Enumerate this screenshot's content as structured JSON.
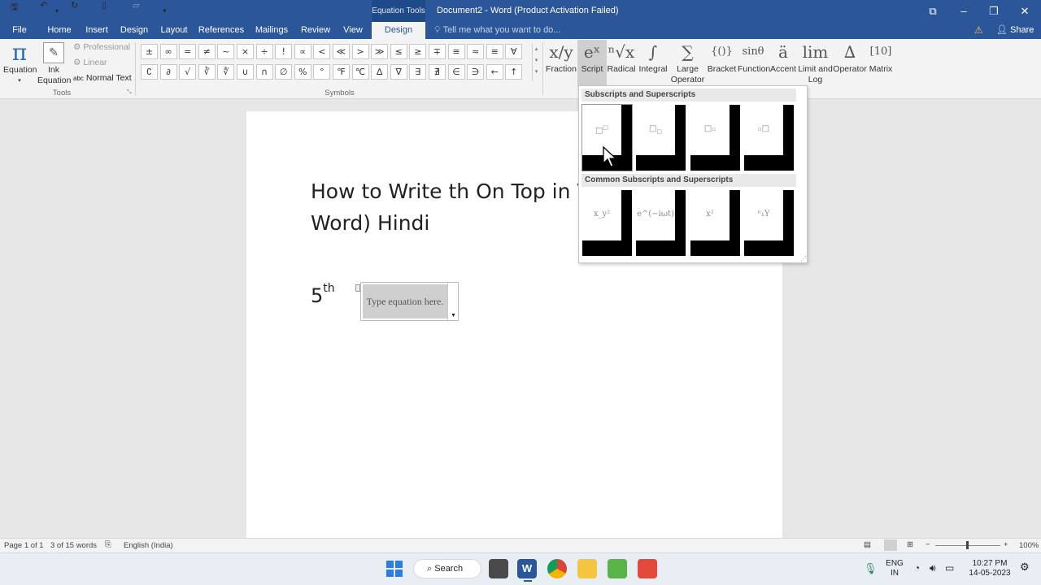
{
  "titlebar": {
    "contextual_label": "Equation Tools",
    "document_title": "Document2 - Word (Product Activation Failed)"
  },
  "tabs": [
    "File",
    "Home",
    "Insert",
    "Design",
    "Layout",
    "References",
    "Mailings",
    "Review",
    "View"
  ],
  "active_tab": "Design",
  "tell_me_placeholder": "Tell me what you want to do...",
  "share_label": "Share",
  "tools": {
    "equation_label": "Equation",
    "ink_label_1": "Ink",
    "ink_label_2": "Equation",
    "professional": "Professional",
    "linear": "Linear",
    "normal_text_prefix": "abc",
    "normal_text": "Normal Text",
    "group_name": "Tools"
  },
  "symbols": {
    "row1": [
      "±",
      "∞",
      "=",
      "≠",
      "~",
      "×",
      "÷",
      "!",
      "∝",
      "<",
      "≪",
      ">",
      "≫",
      "≤",
      "≥",
      "∓",
      "≅",
      "≈",
      "≡",
      "∀"
    ],
    "row2": [
      "∁",
      "∂",
      "√",
      "∛",
      "∜",
      "∪",
      "∩",
      "∅",
      "%",
      "°",
      "℉",
      "℃",
      "∆",
      "∇",
      "∃",
      "∄",
      "∈",
      "∋",
      "←",
      "↑"
    ],
    "group_name": "Symbols"
  },
  "structures": [
    {
      "icon": "x/y",
      "label": "Fraction",
      "label2": ""
    },
    {
      "icon": "eˣ",
      "label": "Script",
      "label2": ""
    },
    {
      "icon": "ⁿ√x",
      "label": "Radical",
      "label2": ""
    },
    {
      "icon": "∫",
      "label": "Integral",
      "label2": ""
    },
    {
      "icon": "∑",
      "label": "Large",
      "label2": "Operator"
    },
    {
      "icon": "{()}",
      "label": "Bracket",
      "label2": ""
    },
    {
      "icon": "sinθ",
      "label": "Function",
      "label2": ""
    },
    {
      "icon": "ä",
      "label": "Accent",
      "label2": ""
    },
    {
      "icon": "lim",
      "label": "Limit and",
      "label2": "Log"
    },
    {
      "icon": "∆",
      "label": "Operator",
      "label2": ""
    },
    {
      "icon": "[10]",
      "label": "Matrix",
      "label2": ""
    }
  ],
  "document": {
    "heading": "How to Write th On Top in Word) Hindi",
    "heading_line1": "How to Write th On Top in V",
    "heading_line2": "Word) Hindi",
    "number": "5",
    "superscript": "th",
    "equation_placeholder": "Type equation here."
  },
  "script_dropdown": {
    "section1": "Subscripts and Superscripts",
    "section2": "Common Subscripts and Superscripts",
    "common_items": [
      "x_y²",
      "e^(−iωt)",
      "x²",
      "ⁿ₁Y"
    ]
  },
  "statusbar": {
    "page": "Page 1 of 1",
    "words": "3 of 15 words",
    "language": "English (India)",
    "zoom": "100%"
  },
  "taskbar": {
    "search": "Search",
    "lang_1": "ENG",
    "lang_2": "IN",
    "time": "10:27 PM",
    "date": "14-05-2023"
  }
}
